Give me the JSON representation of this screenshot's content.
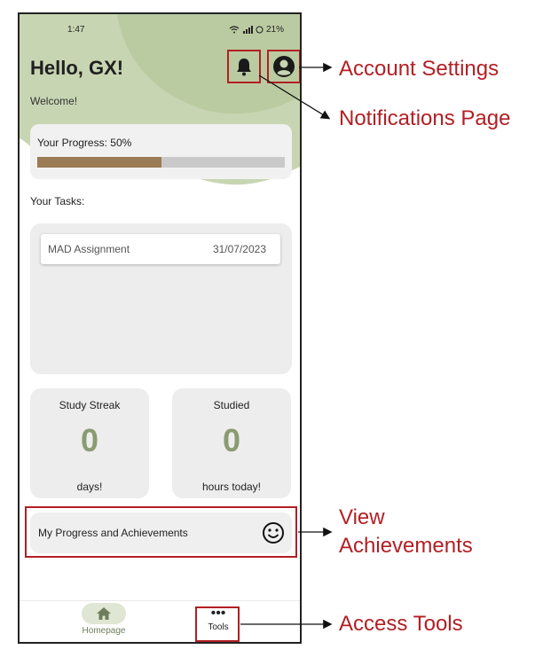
{
  "status_bar": {
    "time": "1:47",
    "battery": "21%"
  },
  "header": {
    "greeting": "Hello, GX!",
    "subtitle": "Welcome!"
  },
  "progress": {
    "label": "Your Progress: 50%",
    "value": 0.5
  },
  "tasks": {
    "title": "Your Tasks:",
    "items": [
      {
        "name": "MAD Assignment",
        "date": "31/07/2023"
      }
    ]
  },
  "stats": [
    {
      "title": "Study Streak",
      "value": "0",
      "unit": "days!"
    },
    {
      "title": "Studied",
      "value": "0",
      "unit": "hours today!"
    }
  ],
  "achievements": {
    "label": "My Progress and Achievements",
    "icon": "smiley-icon"
  },
  "nav": {
    "home_label": "Homepage",
    "tools_label": "Tools",
    "tools_icon": "•••"
  },
  "annotations": {
    "account": "Account Settings",
    "notifications": "Notifications Page",
    "view1": "View",
    "view2": "Achievements",
    "tools": "Access Tools"
  },
  "colors": {
    "accent_green": "#8a9b71",
    "progress_fill": "#9b7b54",
    "annotation_red": "#b21f24"
  }
}
